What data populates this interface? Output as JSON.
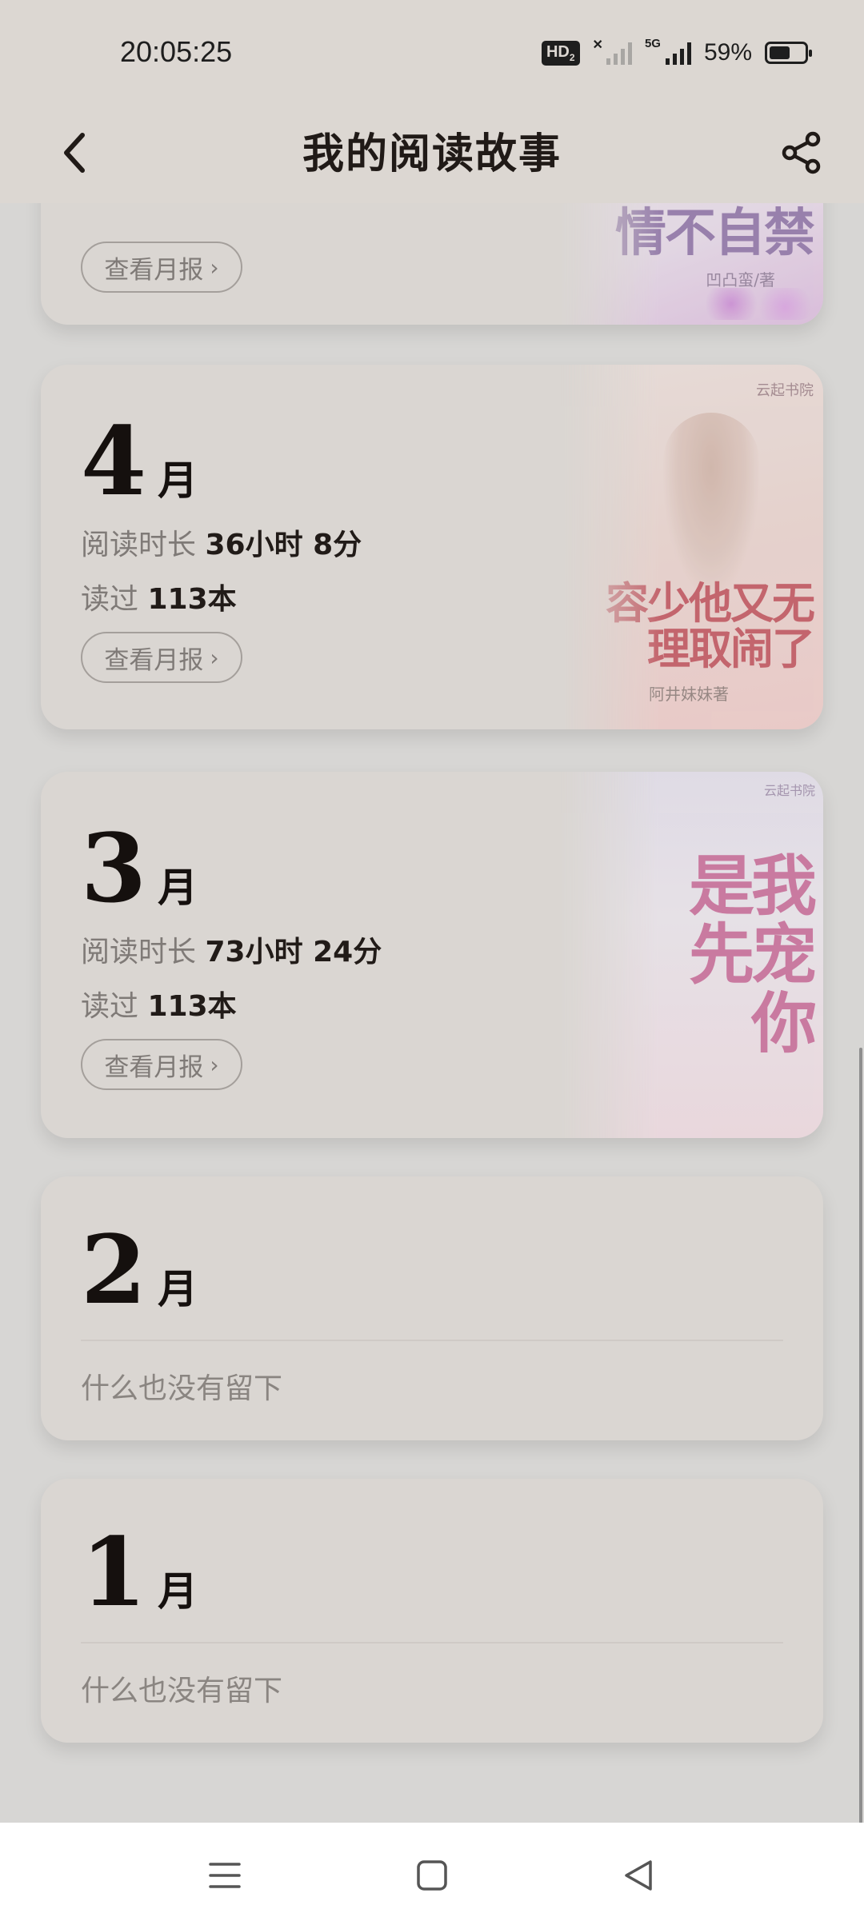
{
  "status_bar": {
    "time": "20:05:25",
    "hd_label": "HD",
    "network": "5G",
    "battery_percent": "59%",
    "battery_level": 0.59
  },
  "header": {
    "title": "我的阅读故事",
    "back_icon": "chevron-left-icon",
    "share_icon": "share-icon"
  },
  "cards": [
    {
      "report_label": "查看月报",
      "cover": {
        "title": "情不自禁",
        "author": "凹凸蛮/著"
      }
    },
    {
      "month": "4",
      "unit": "月",
      "duration_label": "阅读时长",
      "duration_value": "36小时 8分",
      "read_label": "读过",
      "read_value": "113本",
      "report_label": "查看月报",
      "cover": {
        "title": "容少他又无理取闹了",
        "author": "阿井妹妹著",
        "publisher": "云起书院"
      }
    },
    {
      "month": "3",
      "unit": "月",
      "duration_label": "阅读时长",
      "duration_value": "73小时 24分",
      "read_label": "读过",
      "read_value": "113本",
      "report_label": "查看月报",
      "cover": {
        "title": "是我先宠你",
        "publisher": "云起书院"
      }
    },
    {
      "month": "2",
      "unit": "月",
      "empty_text": "什么也没有留下"
    },
    {
      "month": "1",
      "unit": "月",
      "empty_text": "什么也没有留下"
    }
  ],
  "nav": {
    "menu_icon": "menu-icon",
    "home_icon": "home-square-icon",
    "back_icon": "back-triangle-icon"
  },
  "colors": {
    "background": "#d7d6d4",
    "card": "#dad6d2",
    "header": "#dcd7d2",
    "text_dark": "#15100e",
    "text_muted": "#7f7a77"
  }
}
